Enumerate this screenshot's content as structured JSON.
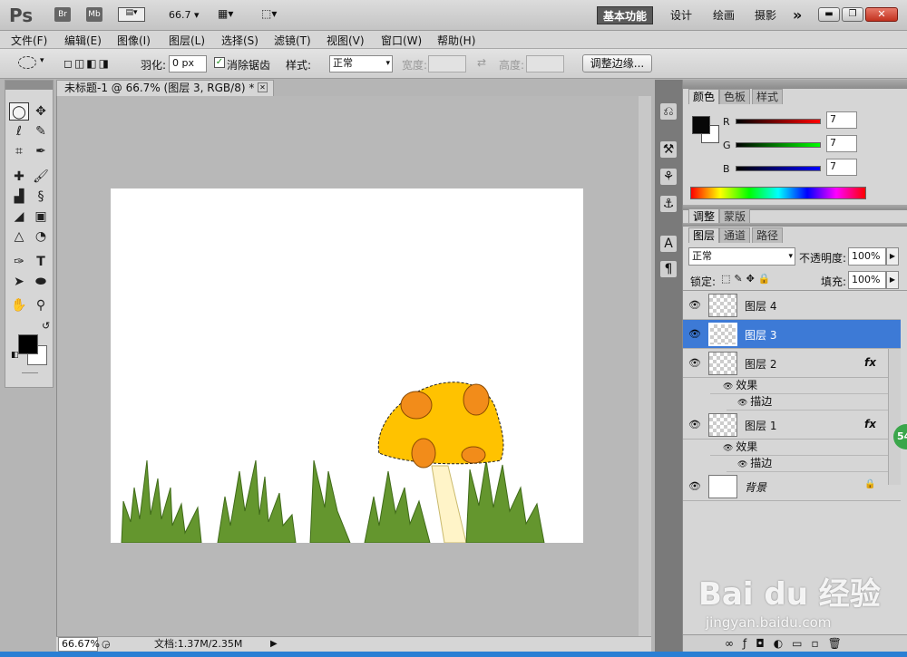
{
  "app": {
    "logo": "Ps",
    "bridge": "Br",
    "minibridge": "Mb",
    "zoom": "66.7",
    "workspaces": [
      "基本功能",
      "设计",
      "绘画",
      "摄影"
    ],
    "more": "»"
  },
  "menu": [
    "文件(F)",
    "编辑(E)",
    "图像(I)",
    "图层(L)",
    "选择(S)",
    "滤镜(T)",
    "视图(V)",
    "窗口(W)",
    "帮助(H)"
  ],
  "options": {
    "feather_label": "羽化:",
    "feather_value": "0 px",
    "antialias_label": "消除锯齿",
    "style_label": "样式:",
    "style_value": "正常",
    "width_label": "宽度:",
    "height_label": "高度:",
    "refine_edge": "调整边缘..."
  },
  "document": {
    "tab_title": "未标题-1 @ 66.7% (图层 3, RGB/8) *",
    "zoom": "66.67%",
    "doc_info": "文档:1.37M/2.35M"
  },
  "color_panel": {
    "tabs": [
      "颜色",
      "色板",
      "样式"
    ],
    "channels": [
      {
        "label": "R",
        "value": "7"
      },
      {
        "label": "G",
        "value": "7"
      },
      {
        "label": "B",
        "value": "7"
      }
    ]
  },
  "adjust_panel": {
    "tabs": [
      "调整",
      "蒙版"
    ]
  },
  "layers_panel": {
    "tabs": [
      "图层",
      "通道",
      "路径"
    ],
    "blend_mode": "正常",
    "opacity_label": "不透明度:",
    "opacity": "100%",
    "lock_label": "锁定:",
    "fill_label": "填充:",
    "fill": "100%",
    "layers": [
      {
        "name": "图层 4",
        "fx": ""
      },
      {
        "name": "图层 3",
        "fx": ""
      },
      {
        "name": "图层 2",
        "fx": "fx"
      },
      {
        "name": "图层 1",
        "fx": "fx"
      },
      {
        "name": "背景",
        "fx": ""
      }
    ],
    "effects_label": "效果",
    "stroke_label": "描边"
  },
  "badge": "54",
  "watermark": {
    "brand": "Bai du 经验",
    "url": "jingyan.baidu.com"
  },
  "colors": {
    "selected": "#3d7ad6",
    "mushroom_cap": "#ffc200",
    "spots": "#f28c1a",
    "grass": "#64962e",
    "stem": "#fff4c8"
  }
}
